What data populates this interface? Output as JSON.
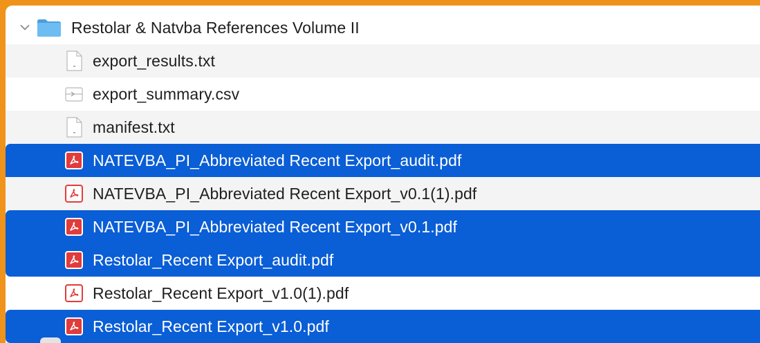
{
  "folder": {
    "name": "Restolar & Natvba References Volume II",
    "expanded": true,
    "icon": "folder-icon"
  },
  "files": [
    {
      "name": "export_results.txt",
      "icon": "text-document-icon",
      "selected": false
    },
    {
      "name": "export_summary.csv",
      "icon": "spreadsheet-document-icon",
      "selected": false
    },
    {
      "name": "manifest.txt",
      "icon": "text-document-icon",
      "selected": false
    },
    {
      "name": "NATEVBA_PI_Abbreviated Recent Export_audit.pdf",
      "icon": "pdf-icon",
      "selected": true
    },
    {
      "name": "NATEVBA_PI_Abbreviated Recent Export_v0.1(1).pdf",
      "icon": "pdf-icon",
      "selected": false
    },
    {
      "name": "NATEVBA_PI_Abbreviated Recent Export_v0.1.pdf",
      "icon": "pdf-icon",
      "selected": true
    },
    {
      "name": "Restolar_Recent Export_audit.pdf",
      "icon": "pdf-icon",
      "selected": true
    },
    {
      "name": "Restolar_Recent Export_v1.0(1).pdf",
      "icon": "pdf-icon",
      "selected": false
    },
    {
      "name": "Restolar_Recent Export_v1.0.pdf",
      "icon": "pdf-icon",
      "selected": true
    }
  ],
  "colors": {
    "selection": "#0a5ed6",
    "alternate_row": "#f4f4f5",
    "frame": "#f0931a",
    "pdf_accent": "#e23b3b",
    "folder": "#5aaeea"
  }
}
